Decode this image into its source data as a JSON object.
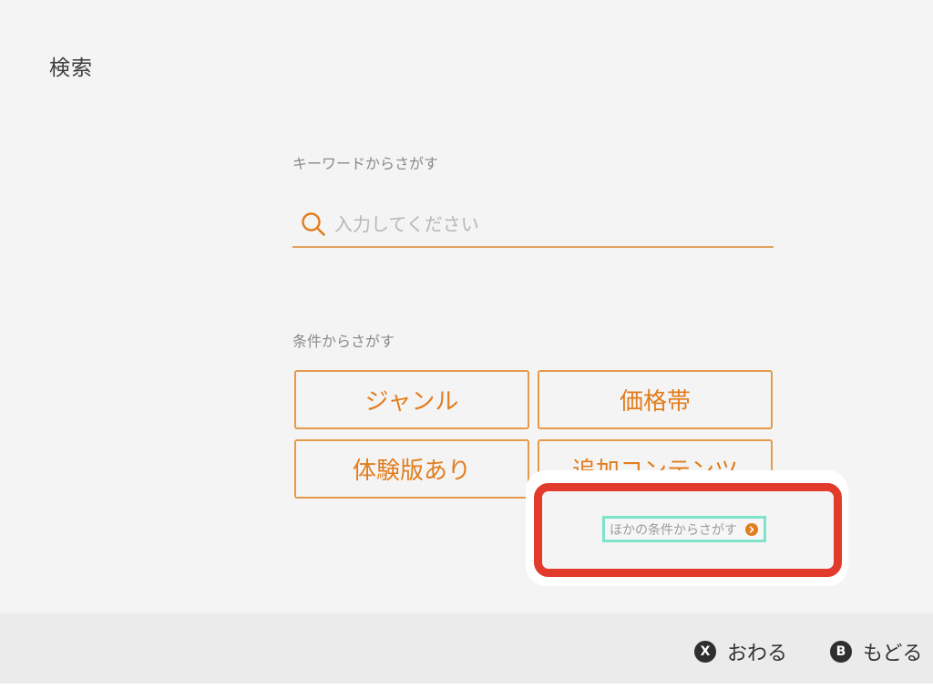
{
  "page": {
    "title": "検索"
  },
  "keyword_search": {
    "label": "キーワードからさがす",
    "placeholder": "入力してください",
    "value": ""
  },
  "condition_search": {
    "label": "条件からさがす",
    "buttons": {
      "genre": "ジャンル",
      "price": "価格帯",
      "demo": "体験版あり",
      "dlc": "追加コンテンツ"
    },
    "more_link": "ほかの条件からさがす"
  },
  "footer": {
    "close": {
      "key": "X",
      "label": "おわる"
    },
    "back": {
      "key": "B",
      "label": "もどる"
    }
  },
  "colors": {
    "accent": "#e27d1e",
    "button_border": "#e59a4a",
    "highlight_red": "#e23b2c",
    "highlight_teal": "#7de3c9",
    "background": "#f4f4f4"
  }
}
